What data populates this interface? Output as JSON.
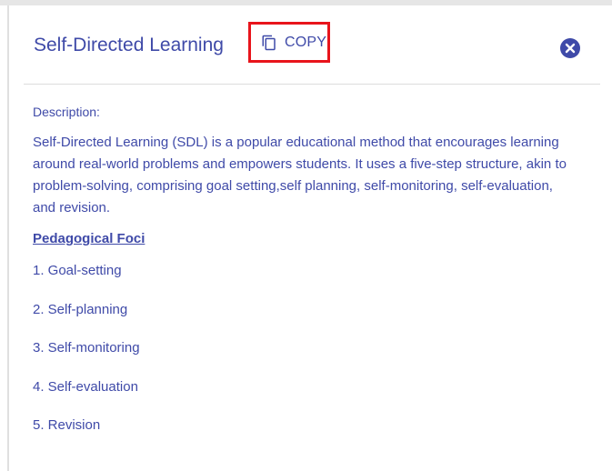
{
  "header": {
    "title": "Self-Directed Learning",
    "copy_label": "COPY"
  },
  "description": {
    "label": "Description:",
    "text": "Self-Directed Learning (SDL) is a popular educational method that encourages learning around real-world problems and empowers students. It uses a five-step structure, akin to problem-solving, comprising goal setting,self planning, self-monitoring, self-evaluation, and revision."
  },
  "foci": {
    "heading": "Pedagogical Foci",
    "items": [
      "1. Goal-setting",
      "2. Self-planning",
      "3. Self-monitoring",
      "4. Self-evaluation",
      "5. Revision"
    ]
  },
  "icons": {
    "copy": "copy-icon",
    "close": "close-icon"
  },
  "colors": {
    "text": "#3f4aa8",
    "highlight_box": "#e8141b",
    "divider": "#dcdcdc"
  }
}
